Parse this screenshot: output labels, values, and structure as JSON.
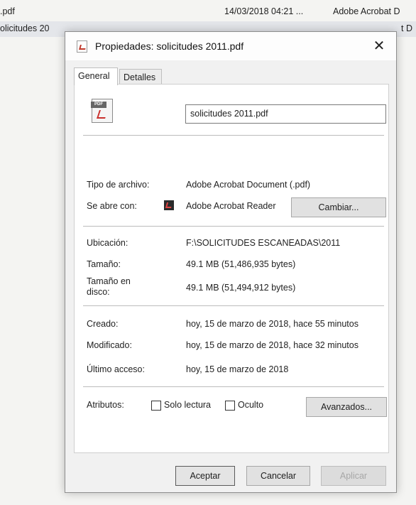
{
  "background_list": {
    "row1": {
      "name": ".pdf",
      "date": "14/03/2018 04:21 ...",
      "type": "Adobe Acrobat D"
    },
    "row2": {
      "name": "olicitudes 20",
      "type": "t D"
    }
  },
  "dialog": {
    "title": "Propiedades: solicitudes 2011.pdf",
    "close_glyph": "✕",
    "tabs": [
      "General",
      "Detalles"
    ],
    "file_icon_badge": "PDF",
    "filename": "solicitudes 2011.pdf",
    "fields": {
      "tipo_label": "Tipo de archivo:",
      "tipo_value": "Adobe Acrobat Document (.pdf)",
      "abre_label": "Se abre con:",
      "abre_value": "Adobe Acrobat Reader",
      "cambiar_button": "Cambiar...",
      "ubicacion_label": "Ubicación:",
      "ubicacion_value": "F:\\SOLICITUDES ESCANEADAS\\2011",
      "tamano_label": "Tamaño:",
      "tamano_value": "49.1 MB (51,486,935 bytes)",
      "tamano_disco_label_1": "Tamaño en",
      "tamano_disco_label_2": "disco:",
      "tamano_disco_value": "49.1 MB (51,494,912 bytes)",
      "creado_label": "Creado:",
      "creado_value": "hoy, 15 de marzo de 2018, hace 55 minutos",
      "modificado_label": "Modificado:",
      "modificado_value": "hoy, 15 de marzo de 2018, hace 32 minutos",
      "acceso_label": "Último acceso:",
      "acceso_value": "hoy, 15 de marzo de 2018",
      "atributos_label": "Atributos:",
      "solo_lectura": "Solo lectura",
      "oculto": "Oculto",
      "avanzados_button": "Avanzados..."
    },
    "buttons": {
      "aceptar": "Aceptar",
      "cancelar": "Cancelar",
      "aplicar": "Aplicar"
    }
  }
}
